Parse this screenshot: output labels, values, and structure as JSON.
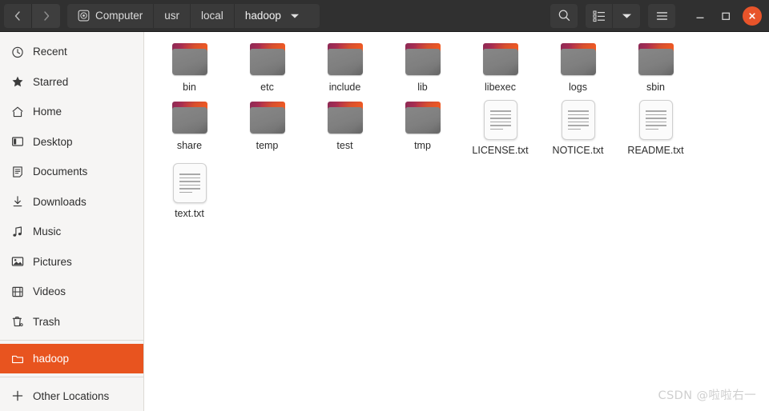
{
  "window": {
    "nav": {
      "back_label": "Back",
      "back_icon": "chevron-left-icon",
      "forward_label": "Forward",
      "forward_icon": "chevron-right-icon"
    },
    "breadcrumbs": [
      {
        "label": "Computer",
        "icon": "disk-icon",
        "current": false
      },
      {
        "label": "usr",
        "icon": "",
        "current": false
      },
      {
        "label": "local",
        "icon": "",
        "current": false
      },
      {
        "label": "hadoop",
        "icon": "",
        "current": true
      }
    ],
    "breadcrumb_caret_icon": "chevron-down-icon",
    "toolbar": {
      "search_label": "Search",
      "search_icon": "search-icon",
      "view_list_label": "List view",
      "view_list_icon": "list-view-icon",
      "view_caret_label": "View options",
      "view_caret_icon": "chevron-down-icon",
      "menu_label": "Main menu",
      "menu_icon": "hamburger-menu-icon"
    },
    "controls": {
      "minimize_label": "Minimize",
      "minimize_icon": "minimize-icon",
      "maximize_label": "Maximize",
      "maximize_icon": "maximize-icon",
      "close_label": "Close",
      "close_icon": "close-icon"
    },
    "accent_color": "#e8541f",
    "header_color": "#303030"
  },
  "sidebar": {
    "items": [
      {
        "label": "Recent",
        "icon": "clock-icon",
        "selected": false
      },
      {
        "label": "Starred",
        "icon": "star-icon",
        "selected": false
      },
      {
        "label": "Home",
        "icon": "home-icon",
        "selected": false
      },
      {
        "label": "Desktop",
        "icon": "desktop-icon",
        "selected": false
      },
      {
        "label": "Documents",
        "icon": "document-icon",
        "selected": false
      },
      {
        "label": "Downloads",
        "icon": "download-icon",
        "selected": false
      },
      {
        "label": "Music",
        "icon": "music-icon",
        "selected": false
      },
      {
        "label": "Pictures",
        "icon": "picture-icon",
        "selected": false
      },
      {
        "label": "Videos",
        "icon": "video-icon",
        "selected": false
      },
      {
        "label": "Trash",
        "icon": "trash-icon",
        "selected": false
      },
      {
        "label": "hadoop",
        "icon": "folder-icon",
        "selected": true
      },
      {
        "label": "Other Locations",
        "icon": "plus-icon",
        "selected": false
      }
    ]
  },
  "files": [
    {
      "name": "bin",
      "type": "folder"
    },
    {
      "name": "etc",
      "type": "folder"
    },
    {
      "name": "include",
      "type": "folder"
    },
    {
      "name": "lib",
      "type": "folder"
    },
    {
      "name": "libexec",
      "type": "folder"
    },
    {
      "name": "logs",
      "type": "folder"
    },
    {
      "name": "sbin",
      "type": "folder"
    },
    {
      "name": "share",
      "type": "folder"
    },
    {
      "name": "temp",
      "type": "folder"
    },
    {
      "name": "test",
      "type": "folder"
    },
    {
      "name": "tmp",
      "type": "folder"
    },
    {
      "name": "LICENSE.txt",
      "type": "text"
    },
    {
      "name": "NOTICE.txt",
      "type": "text"
    },
    {
      "name": "README.txt",
      "type": "text"
    },
    {
      "name": "text.txt",
      "type": "text"
    }
  ],
  "watermark": {
    "text": "CSDN @啦啦右一"
  }
}
